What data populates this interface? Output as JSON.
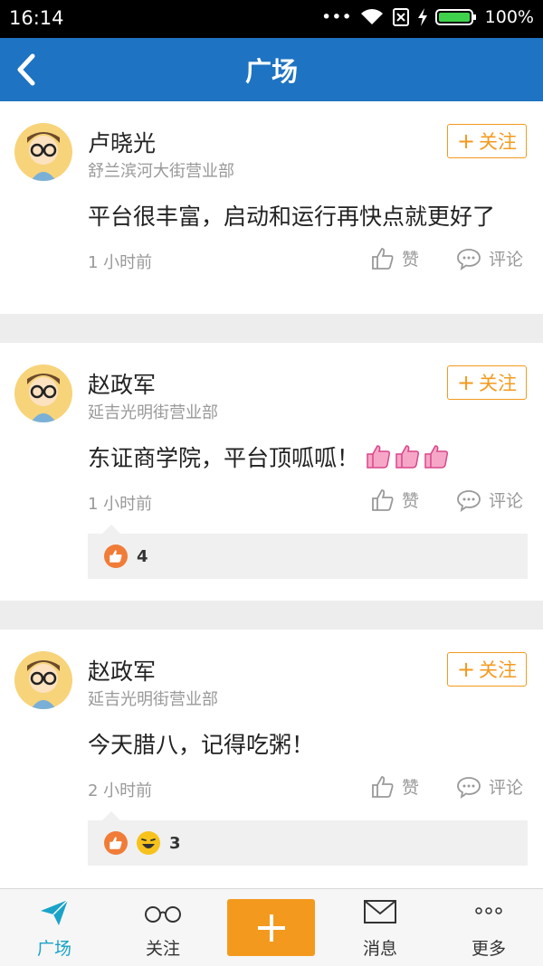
{
  "status_bar": {
    "time": "16:14",
    "battery": "100%"
  },
  "header": {
    "title": "广场"
  },
  "posts": [
    {
      "name": "卢晓光",
      "dept": "舒兰滨河大街营业部",
      "follow_label": "关注",
      "content": "平台很丰富，启动和运行再快点就更好了",
      "time": "1 小时前",
      "like_label": "赞",
      "comment_label": "评论"
    },
    {
      "name": "赵政军",
      "dept": "延吉光明街营业部",
      "follow_label": "关注",
      "content": "东证商学院，平台顶呱呱！",
      "time": "1 小时前",
      "like_label": "赞",
      "comment_label": "评论",
      "reactions": {
        "count": "4"
      }
    },
    {
      "name": "赵政军",
      "dept": "延吉光明街营业部",
      "follow_label": "关注",
      "content": "今天腊八，记得吃粥！",
      "time": "2 小时前",
      "like_label": "赞",
      "comment_label": "评论",
      "reactions": {
        "count": "3"
      }
    }
  ],
  "tabbar": {
    "items": [
      {
        "label": "广场",
        "icon": "paper-plane-icon",
        "active": true
      },
      {
        "label": "关注",
        "icon": "glasses-icon"
      },
      {
        "label": "",
        "icon": "plus-icon"
      },
      {
        "label": "消息",
        "icon": "envelope-icon"
      },
      {
        "label": "更多",
        "icon": "more-dots-icon"
      }
    ]
  },
  "colors": {
    "header": "#1e73c2",
    "accent": "#f39a1e",
    "active_tab": "#1aa3c8"
  }
}
